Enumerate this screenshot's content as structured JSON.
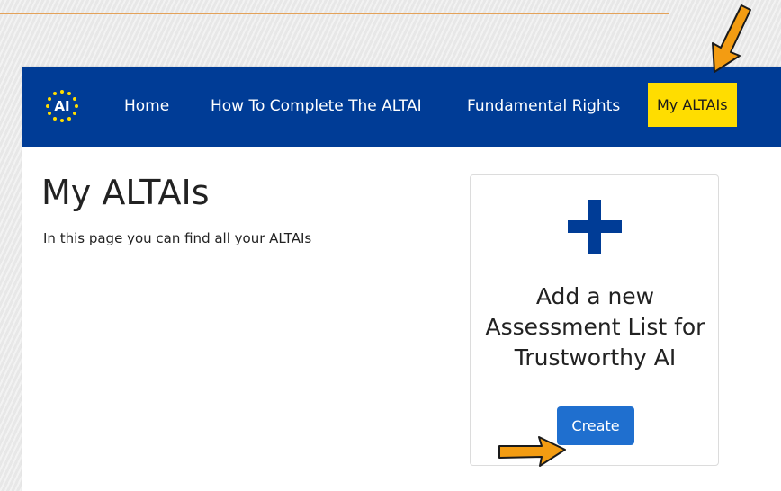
{
  "nav": {
    "logo_text": "AI",
    "items": [
      {
        "label": "Home"
      },
      {
        "label": "How To Complete The ALTAI"
      },
      {
        "label": "Fundamental Rights"
      },
      {
        "label": "My ALTAIs",
        "active": true
      }
    ]
  },
  "page": {
    "title": "My ALTAIs",
    "subtitle": "In this page you can find all your ALTAIs"
  },
  "card": {
    "icon": "plus-icon",
    "lines": [
      "Add a new",
      "Assessment List for",
      "Trustworthy AI"
    ],
    "button_label": "Create"
  },
  "colors": {
    "navbar": "#003c96",
    "active_tab": "#ffdd00",
    "button": "#1f6fcf",
    "plus": "#003c96",
    "arrow": "#f39c12",
    "rule": "#e3a25a"
  },
  "annotations": [
    "arrow-icon",
    "arrow-icon"
  ]
}
